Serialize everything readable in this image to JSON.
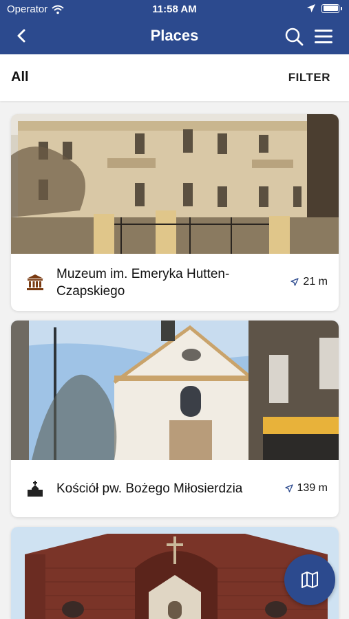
{
  "status_bar": {
    "carrier": "Operator",
    "time": "11:58 AM"
  },
  "nav": {
    "title": "Places"
  },
  "filter_bar": {
    "scope_label": "All",
    "filter_label": "FILTER"
  },
  "places": [
    {
      "name": "Muzeum im. Emeryka Hutten-Czapskiego",
      "distance": "21 m",
      "category_icon": "museum-icon"
    },
    {
      "name": "Kościół pw. Bożego Miłosierdzia",
      "distance": "139 m",
      "category_icon": "church-icon"
    },
    {
      "name": "",
      "distance": "",
      "category_icon": ""
    }
  ],
  "colors": {
    "primary": "#2c4a8e",
    "accent_icon": "#7a3b12",
    "background": "#f2f2f2"
  }
}
